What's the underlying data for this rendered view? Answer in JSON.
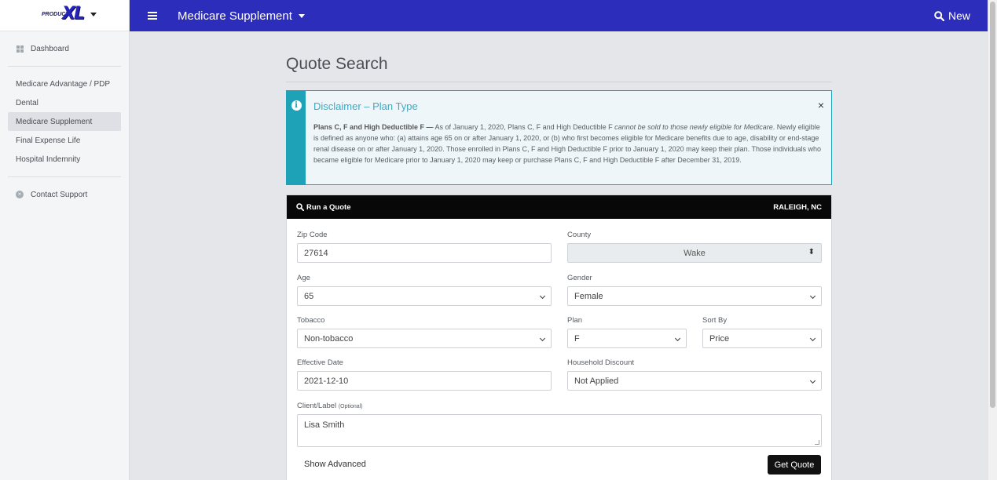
{
  "brand": {
    "logo_word": "PRODUCTS",
    "logo_mark": "XL"
  },
  "sidebar": {
    "items": [
      {
        "label": "Dashboard",
        "icon": "grid-icon"
      },
      {
        "label": "Medicare Advantage / PDP"
      },
      {
        "label": "Dental"
      },
      {
        "label": "Medicare Supplement",
        "active": true
      },
      {
        "label": "Final Expense Life"
      },
      {
        "label": "Hospital Indemnity"
      },
      {
        "label": "Contact Support",
        "icon": "close-circle-icon"
      }
    ]
  },
  "topbar": {
    "title": "Medicare Supplement",
    "new_label": "New",
    "color": "#2d2dbc"
  },
  "page": {
    "title": "Quote Search"
  },
  "disclaimer": {
    "title": "Disclaimer – Plan Type",
    "bold_lead": "Plans C, F and High Deductible F —",
    "text_a": " As of January 1, 2020, Plans C, F and High Deductible F ",
    "text_italic": "cannot be sold to those newly eligible for Medicare",
    "text_b": ". Newly eligible is defined as anyone who: (a) attains age 65 on or after January 1, 2020, or (b) who first becomes eligible for Medicare benefits due to age, disability or end-stage renal disease on or after January 1, 2020. Those enrolled in Plans C, F and High Deductible F prior to January 1, 2020 may keep their plan. Those individuals who became eligible for Medicare prior to January 1, 2020 may keep or purchase Plans C, F and High Deductible F after December 31, 2019.",
    "close": "×",
    "accent": "#1ea2b8"
  },
  "quote": {
    "header": "Run a Quote",
    "location": "RALEIGH, NC",
    "zip_label": "Zip Code",
    "zip_value": "27614",
    "county_label": "County",
    "county_value": "Wake",
    "age_label": "Age",
    "age_value": "65",
    "gender_label": "Gender",
    "gender_value": "Female",
    "tobacco_label": "Tobacco",
    "tobacco_value": "Non-tobacco",
    "plan_label": "Plan",
    "plan_value": "F",
    "sort_label": "Sort By",
    "sort_value": "Price",
    "date_label": "Effective Date",
    "date_value": "2021-12-10",
    "household_label": "Household Discount",
    "household_value": "Not Applied",
    "client_label": "Client/Label",
    "client_optional": "(Optional)",
    "client_value": "Lisa Smith",
    "show_advanced": "Show Advanced",
    "get_quote": "Get Quote"
  }
}
